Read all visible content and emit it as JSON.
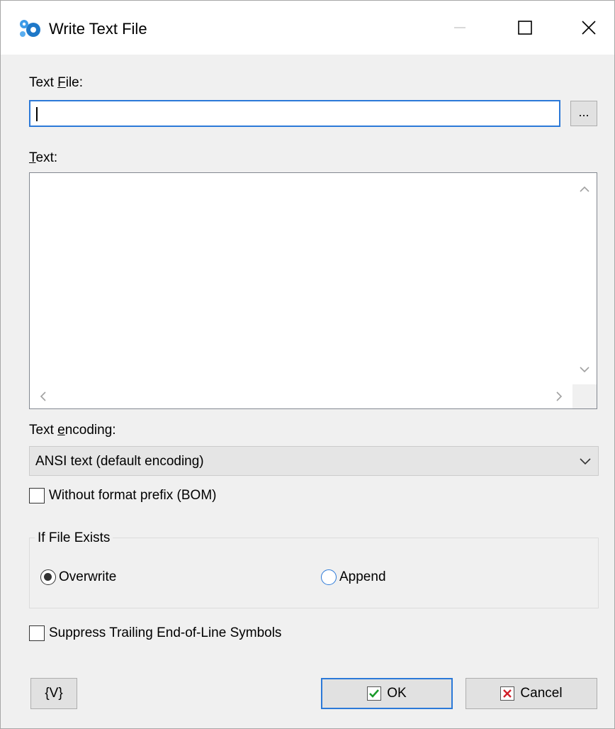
{
  "window": {
    "title": "Write Text File",
    "icon": "gears-app-icon"
  },
  "titlebar_buttons": {
    "minimize": "minimize-icon",
    "maximize": "maximize-icon",
    "close": "close-icon"
  },
  "text_file": {
    "label_prefix": "Text ",
    "label_accel": "F",
    "label_suffix": "ile:",
    "value": "",
    "browse_label": "..."
  },
  "text": {
    "label_accel": "T",
    "label_suffix": "ext:",
    "value": ""
  },
  "encoding": {
    "label_prefix": "Text ",
    "label_accel": "e",
    "label_suffix": "ncoding:",
    "selected": "ANSI text (default encoding)"
  },
  "bom_checkbox": {
    "label": "Without format prefix (BOM)",
    "checked": false
  },
  "if_file_exists": {
    "title": "If File Exists",
    "options": [
      {
        "label": "Overwrite",
        "checked": true
      },
      {
        "label": "Append",
        "checked": false
      }
    ]
  },
  "suppress_checkbox": {
    "label": "Suppress Trailing End-of-Line Symbols",
    "checked": false
  },
  "buttons": {
    "variables": "{V}",
    "ok": "OK",
    "cancel": "Cancel"
  },
  "colors": {
    "focus_blue": "#2b79d8",
    "ok_check_green": "#1a9a2a",
    "cancel_x_red": "#d2202a"
  }
}
